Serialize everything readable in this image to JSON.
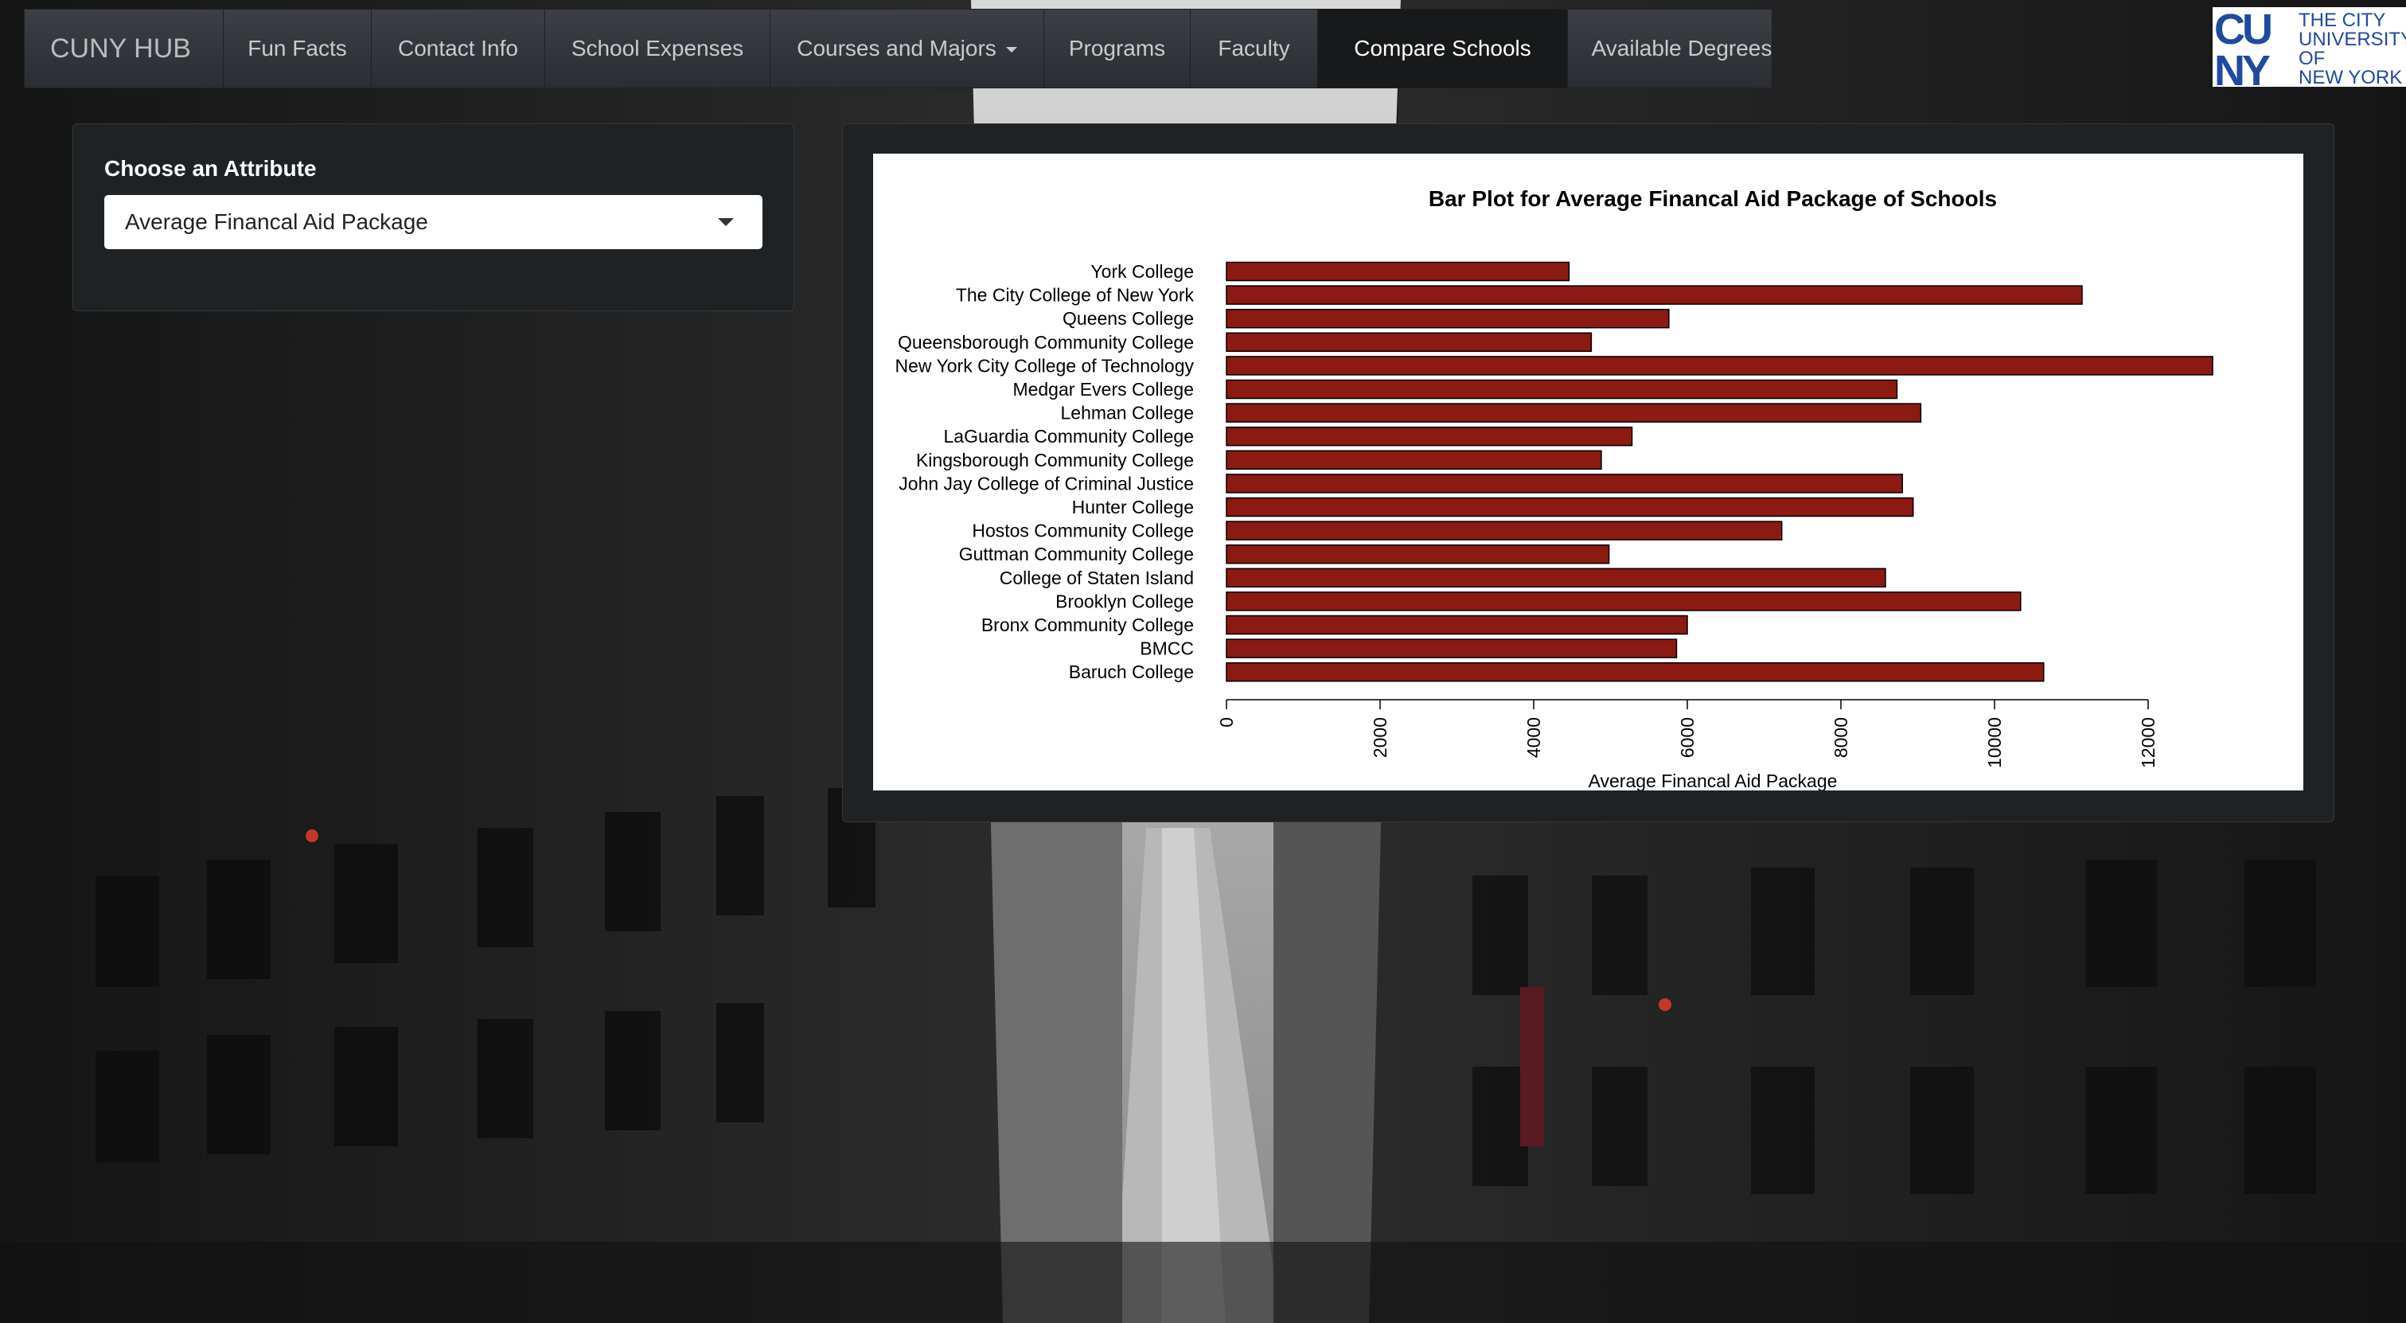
{
  "navbar": {
    "brand": "CUNY HUB",
    "items": [
      {
        "label": "Fun Facts"
      },
      {
        "label": "Contact Info"
      },
      {
        "label": "School Expenses"
      },
      {
        "label": "Courses and Majors"
      },
      {
        "label": "Programs"
      },
      {
        "label": "Faculty"
      },
      {
        "label": "Compare Schools"
      },
      {
        "label": "Available Degrees"
      }
    ],
    "active_item": "Compare Schools"
  },
  "logo": {
    "mark_top": "CU",
    "mark_bottom": "NY",
    "lines": [
      "THE CITY",
      "UNIVERSITY",
      "OF",
      "NEW YORK"
    ],
    "color": "#1f4aa0"
  },
  "sidebar": {
    "label": "Choose an Attribute",
    "select_value": "Average Financal Aid Package"
  },
  "chart_data": {
    "type": "bar",
    "orientation": "horizontal",
    "title": "Bar Plot for Average Financal Aid Package of Schools",
    "xlabel": "Average Financal Aid Package",
    "xlim": [
      0,
      12000
    ],
    "xticks": [
      "0",
      "2000",
      "4000",
      "6000",
      "8000",
      "10000",
      "12000"
    ],
    "bar_color": "#8b1a12",
    "categories": [
      "York College",
      "The City College of New York",
      "Queens College",
      "Queensborough Community College",
      "New York City College of Technology",
      "Medgar Evers College",
      "Lehman College",
      "LaGuardia Community College",
      "Kingsborough Community College",
      "John Jay College of Criminal Justice",
      "Hunter College",
      "Hostos Community College",
      "Guttman Community College",
      "College of Staten Island",
      "Brooklyn College",
      "Bronx Community College",
      "BMCC",
      "Baruch College"
    ],
    "values": [
      4460,
      11140,
      5760,
      4750,
      12840,
      8730,
      9040,
      5280,
      4880,
      8800,
      8940,
      7230,
      4980,
      8580,
      10340,
      6000,
      5860,
      10640
    ]
  }
}
